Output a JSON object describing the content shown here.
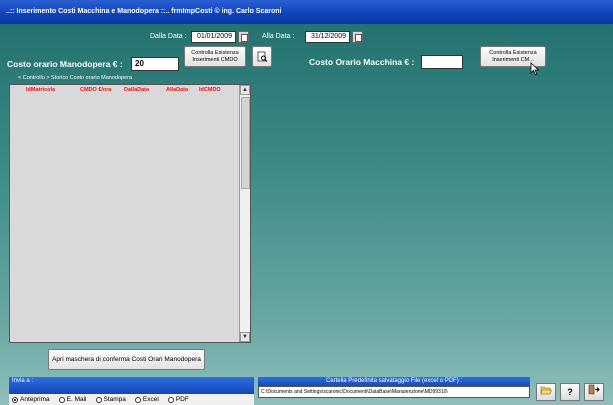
{
  "window": {
    "title": "..:: Inserimento Costi Macchina e Manodopera ::..   frmImpCosti © ing. Carlo Scaroni"
  },
  "dates": {
    "from_label": "Dalla Data :",
    "from_value": "01/01/2009",
    "to_label": "Alla Data :",
    "to_value": "31/12/2009"
  },
  "labor": {
    "label": "Costo orario Manodopera € :",
    "value": "20",
    "check_button": "Controlla Esistenza Inserimenti CMDO"
  },
  "machine": {
    "label": "Costo Orario Macchina € :",
    "value": "",
    "check_button": "Controlla Esistenza Inserimenti CM..."
  },
  "history": {
    "caption": "< Controllo > Storico Costo orario Manodopera",
    "columns": [
      "IdMatricola",
      "CMDO €/ora",
      "DallaData",
      "AllaData",
      "IdCMDO"
    ]
  },
  "confirm_button": "Apri maschera di conferma Costi Orari Manodopera",
  "send": {
    "label": "Invia a :",
    "options": [
      "Anteprima",
      "E. Mail",
      "Stampa",
      "Excel",
      "PDF"
    ],
    "selected": "Anteprima"
  },
  "folder": {
    "label": "Cartella Predefinita salvataggio File (excel o PDF) :",
    "path": "C:\\Documents and Settings\\scaronic\\Documenti\\DataBase\\Manutenzione\\MD99310\\"
  },
  "icons": {
    "open_folder": "folder-open-icon",
    "help": "question-icon",
    "exit": "exit-door-icon",
    "preview": "document-magnifier-icon",
    "calendar": "calendar-icon",
    "cursor": "mouse-pointer-icon"
  },
  "colors": {
    "title_bar": "#0d42b8",
    "background": "#3b8a86",
    "column_header": "#e8141e"
  }
}
